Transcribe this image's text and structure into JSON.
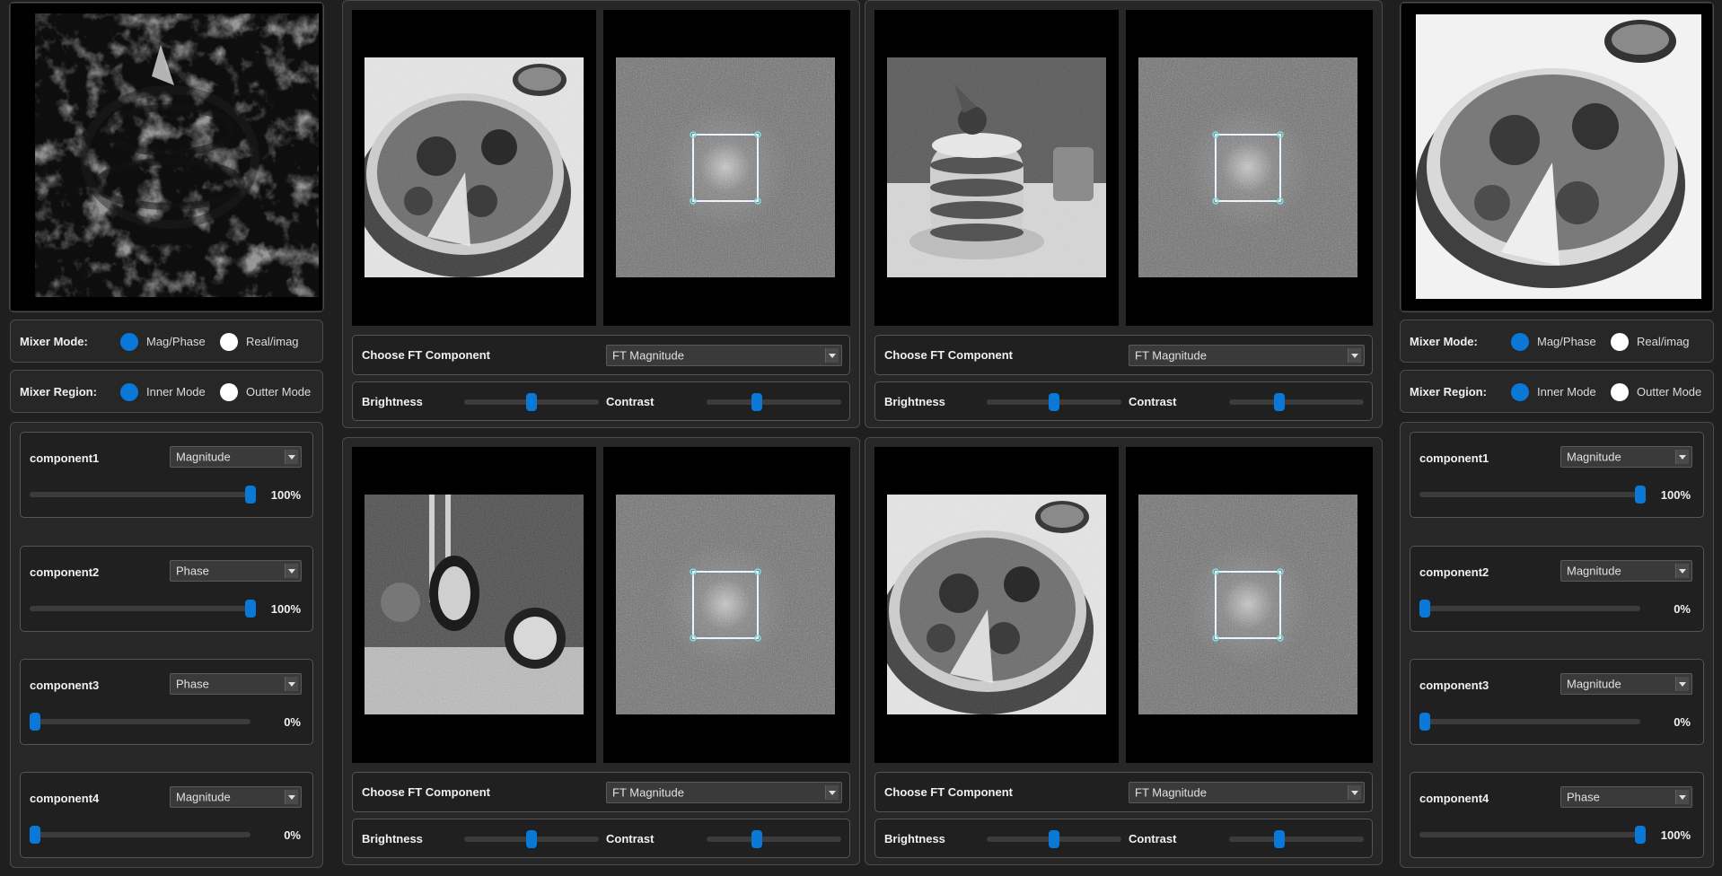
{
  "left_mixer": {
    "mixer_mode_label": "Mixer Mode:",
    "mag_phase_label": "Mag/Phase",
    "real_imag_label": "Real/imag",
    "mixer_region_label": "Mixer Region:",
    "inner_label": "Inner Mode",
    "outer_label": "Outter Mode",
    "components": [
      {
        "name": "component1",
        "type": "Magnitude",
        "value": "100%",
        "level": 1.0
      },
      {
        "name": "component2",
        "type": "Phase",
        "value": "100%",
        "level": 1.0
      },
      {
        "name": "component3",
        "type": "Phase",
        "value": "0%",
        "level": 0.0
      },
      {
        "name": "component4",
        "type": "Magnitude",
        "value": "0%",
        "level": 0.0
      }
    ]
  },
  "right_mixer": {
    "mixer_mode_label": "Mixer Mode:",
    "mag_phase_label": "Mag/Phase",
    "real_imag_label": "Real/imag",
    "mixer_region_label": "Mixer Region:",
    "inner_label": "Inner Mode",
    "outer_label": "Outter Mode",
    "components": [
      {
        "name": "component1",
        "type": "Magnitude",
        "value": "100%",
        "level": 1.0
      },
      {
        "name": "component2",
        "type": "Magnitude",
        "value": "0%",
        "level": 0.0
      },
      {
        "name": "component3",
        "type": "Magnitude",
        "value": "0%",
        "level": 0.0
      },
      {
        "name": "component4",
        "type": "Phase",
        "value": "100%",
        "level": 1.0
      }
    ]
  },
  "viewers": [
    {
      "choose_label": "Choose FT Component",
      "selected": "FT Magnitude",
      "brightness_label": "Brightness",
      "contrast_label": "Contrast",
      "brightness": 0.5,
      "contrast": 0.35
    },
    {
      "choose_label": "Choose FT Component",
      "selected": "FT Magnitude",
      "brightness_label": "Brightness",
      "contrast_label": "Contrast",
      "brightness": 0.5,
      "contrast": 0.35
    },
    {
      "choose_label": "Choose FT Component",
      "selected": "FT Magnitude",
      "brightness_label": "Brightness",
      "contrast_label": "Contrast",
      "brightness": 0.5,
      "contrast": 0.35
    },
    {
      "choose_label": "Choose FT Component",
      "selected": "FT Magnitude",
      "brightness_label": "Brightness",
      "contrast_label": "Contrast",
      "brightness": 0.5,
      "contrast": 0.35
    }
  ],
  "colors": {
    "accent": "#0a78d7",
    "background": "#1f1f1f",
    "panel": "#272727"
  }
}
